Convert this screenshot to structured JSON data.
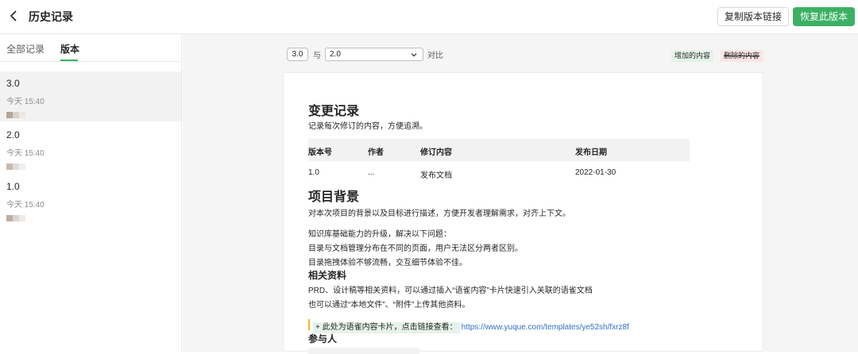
{
  "header": {
    "title": "历史记录",
    "copy_link_label": "复制版本链接",
    "restore_label": "恢复此版本"
  },
  "sidebar": {
    "tabs": [
      {
        "label": "全部记录",
        "active": false
      },
      {
        "label": "版本",
        "active": true
      }
    ],
    "versions": [
      {
        "name": "3.0",
        "time": "今天 15:40",
        "selected": true
      },
      {
        "name": "2.0",
        "time": "今天 15:40",
        "selected": false
      },
      {
        "name": "1.0",
        "time": "今天 15:40",
        "selected": false
      }
    ]
  },
  "compare": {
    "current": "3.0",
    "with_label": "与",
    "target": "2.0",
    "action_label": "对比",
    "legend_added": "增加的内容",
    "legend_deleted": "删除的内容"
  },
  "doc": {
    "changelog_title": "变更记录",
    "changelog_desc": "记录每次修订的内容，方便追溯。",
    "table_headers": [
      "版本号",
      "作者",
      "修订内容",
      "发布日期"
    ],
    "table_rows": [
      [
        "1.0",
        "...",
        "发布文档",
        "2022-01-30"
      ]
    ],
    "bg_title": "项目背景",
    "bg_desc": "对本次项目的背景以及目标进行描述，方便开发者理解需求，对齐上下文。",
    "bg_lines": [
      "知识库基础能力的升级，解决以下问题：",
      "目录与文档管理分布在不同的页面，用户无法区分两者区别。",
      "目录拖拽体验不够流畅，交互细节体验不佳。"
    ],
    "res_title": "相关资料",
    "res_lines": [
      "PRD、设计稿等相关资料，可以通过插入“语雀内容”卡片快速引入关联的语雀文档",
      "也可以通过“本地文件”、“附件”上传其他资料。"
    ],
    "card_text": "+ 此处为语雀内容卡片，点击链接查看：",
    "card_link": "https://www.yuque.com/templates/ye52sh/fxrz8f",
    "participants_title": "参与人"
  },
  "colors": {
    "accent": "#3cb064",
    "added_bg": "#e5f3ea",
    "deleted_bg": "#fbe5e6",
    "link": "#3071c4",
    "card_bar": "#f5b72c"
  },
  "icons": {
    "back": "chevron-left-icon",
    "dropdown": "chevron-down-icon",
    "avatar": "avatar-icon"
  }
}
